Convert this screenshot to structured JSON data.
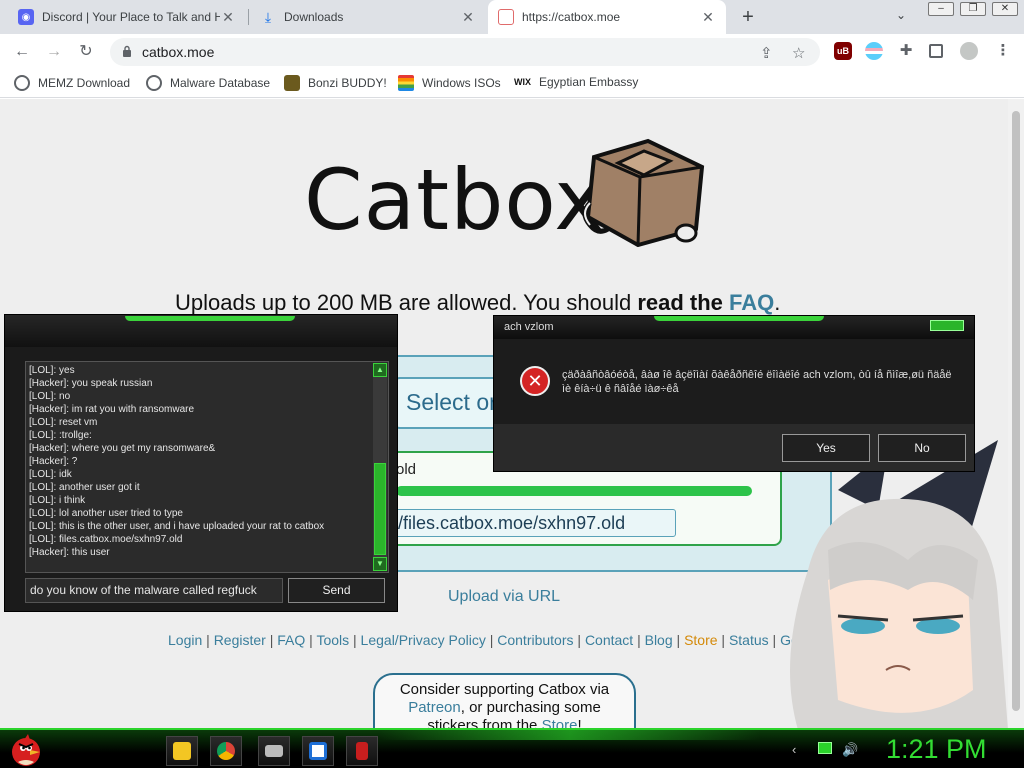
{
  "browser": {
    "tabs": [
      {
        "title": "Discord | Your Place to Talk and H",
        "favicon": "discord-icon",
        "active": false
      },
      {
        "title": "Downloads",
        "favicon": "download-icon",
        "active": false
      },
      {
        "title": "https://catbox.moe",
        "favicon": "catbox-icon",
        "active": true
      }
    ],
    "new_tab": "+",
    "url": "catbox.moe",
    "bookmarks": [
      {
        "label": "MEMZ Download",
        "icon": "globe-icon"
      },
      {
        "label": "Malware Database",
        "icon": "globe-icon"
      },
      {
        "label": "Bonzi BUDDY!",
        "icon": "bonzi-icon"
      },
      {
        "label": "Windows ISOs",
        "icon": "windows-icon"
      },
      {
        "label": "Egyptian Embassy",
        "icon": "wix-icon"
      }
    ],
    "wix_label": "WIX"
  },
  "page": {
    "logo": "Catbox",
    "tagline_prefix": "Uploads up to 200 MB are allowed. You should ",
    "tagline_bold": "read the ",
    "tagline_link": "FAQ",
    "tagline_suffix": ".",
    "select_button": "Select or",
    "file_name": "old",
    "file_url": "//files.catbox.moe/sxhn97.old",
    "upload_progress": 1.0,
    "upload_via_url": "Upload via URL",
    "footer_links": [
      "Login",
      "Register",
      "FAQ",
      "Tools",
      "Legal/Privacy Policy",
      "Contributors",
      "Contact",
      "Blog",
      "Store",
      "Status",
      "Go Dark?"
    ],
    "support_text_1": "Consider supporting Catbox via",
    "support_link_patreon": "Patreon",
    "support_text_2": ", or purchasing some",
    "support_text_3": "stickers from the ",
    "support_link_store": "Store",
    "support_text_4": "!"
  },
  "chat": {
    "messages": [
      "[LOL]: yes",
      "[Hacker]: you speak russian",
      "[LOL]: no",
      "[Hacker]: im rat you with ransomware",
      "[LOL]: reset vm",
      "[LOL]: :trollge:",
      "[Hacker]: where you get my ransomware&",
      "[Hacker]: ?",
      "[LOL]: idk",
      "[LOL]: another user got it",
      "[LOL]: i think",
      "[LOL]: lol another user tried to type",
      "[LOL]: this is the other user, and i have uploaded your rat to catbox",
      "[LOL]: files.catbox.moe/sxhn97.old",
      "[Hacker]: this user"
    ],
    "input_value": "do you know of the malware called regfuck",
    "send_label": "Send"
  },
  "dialog": {
    "title": "ach vzlom",
    "message": "çäðàâñòâóéòå, âàø îê âçëîìàí õàêåðñêîé ëîìàëîé ach vzlom, òû íå ñìîæ,øü ñäåë ìè êíà÷ü ê ñâîåé ìàø÷êå",
    "yes_label": "Yes",
    "no_label": "No",
    "icon": "error-icon"
  },
  "taskbar": {
    "clock": "1:21 PM",
    "apps": [
      "file-explorer-icon",
      "chrome-icon",
      "printer-icon",
      "app-window-icon",
      "red-app-icon"
    ]
  },
  "colors": {
    "accent_green": "#2bd32b",
    "catbox_link": "#3a7e9c",
    "store_link": "#d48a0a",
    "error_red": "#d42424"
  }
}
